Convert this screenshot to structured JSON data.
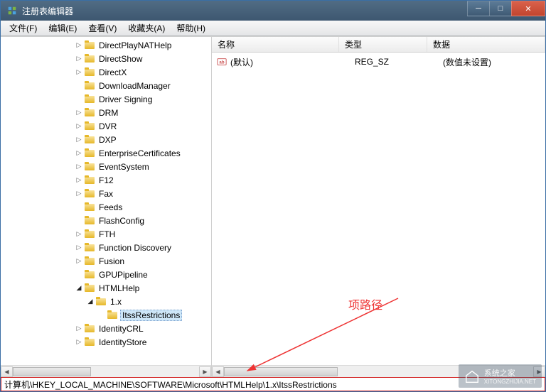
{
  "window": {
    "title": "注册表编辑器"
  },
  "menu": {
    "file": "文件(F)",
    "edit": "编辑(E)",
    "view": "查看(V)",
    "favorites": "收藏夹(A)",
    "help": "帮助(H)"
  },
  "tree": {
    "items": [
      {
        "label": "DirectPlayNATHelp",
        "indent": 96,
        "twist": "closed"
      },
      {
        "label": "DirectShow",
        "indent": 96,
        "twist": "closed"
      },
      {
        "label": "DirectX",
        "indent": 96,
        "twist": "closed"
      },
      {
        "label": "DownloadManager",
        "indent": 96,
        "twist": "none"
      },
      {
        "label": "Driver Signing",
        "indent": 96,
        "twist": "none"
      },
      {
        "label": "DRM",
        "indent": 96,
        "twist": "closed"
      },
      {
        "label": "DVR",
        "indent": 96,
        "twist": "closed"
      },
      {
        "label": "DXP",
        "indent": 96,
        "twist": "closed"
      },
      {
        "label": "EnterpriseCertificates",
        "indent": 96,
        "twist": "closed"
      },
      {
        "label": "EventSystem",
        "indent": 96,
        "twist": "closed"
      },
      {
        "label": "F12",
        "indent": 96,
        "twist": "closed"
      },
      {
        "label": "Fax",
        "indent": 96,
        "twist": "closed"
      },
      {
        "label": "Feeds",
        "indent": 96,
        "twist": "none"
      },
      {
        "label": "FlashConfig",
        "indent": 96,
        "twist": "none"
      },
      {
        "label": "FTH",
        "indent": 96,
        "twist": "closed"
      },
      {
        "label": "Function Discovery",
        "indent": 96,
        "twist": "closed"
      },
      {
        "label": "Fusion",
        "indent": 96,
        "twist": "closed"
      },
      {
        "label": "GPUPipeline",
        "indent": 96,
        "twist": "none"
      },
      {
        "label": "HTMLHelp",
        "indent": 96,
        "twist": "open"
      },
      {
        "label": "1.x",
        "indent": 112,
        "twist": "open"
      },
      {
        "label": "ItssRestrictions",
        "indent": 128,
        "twist": "none",
        "selected": true
      },
      {
        "label": "IdentityCRL",
        "indent": 96,
        "twist": "closed"
      },
      {
        "label": "IdentityStore",
        "indent": 96,
        "twist": "closed"
      }
    ]
  },
  "list": {
    "columns": {
      "name": "名称",
      "type": "类型",
      "data": "数据"
    },
    "rows": [
      {
        "name": "(默认)",
        "type": "REG_SZ",
        "data": "(数值未设置)"
      }
    ]
  },
  "statusbar": {
    "path": "计算机\\HKEY_LOCAL_MACHINE\\SOFTWARE\\Microsoft\\HTMLHelp\\1.x\\ItssRestrictions"
  },
  "annotation": {
    "label": "项路径"
  },
  "watermark": {
    "text": "系统之家",
    "url": "XITONGZHIJIA.NET"
  },
  "twist_glyphs": {
    "closed": "▷",
    "open": "◢",
    "none": ""
  },
  "win_buttons": {
    "min": "─",
    "max": "□",
    "close": "✕"
  }
}
